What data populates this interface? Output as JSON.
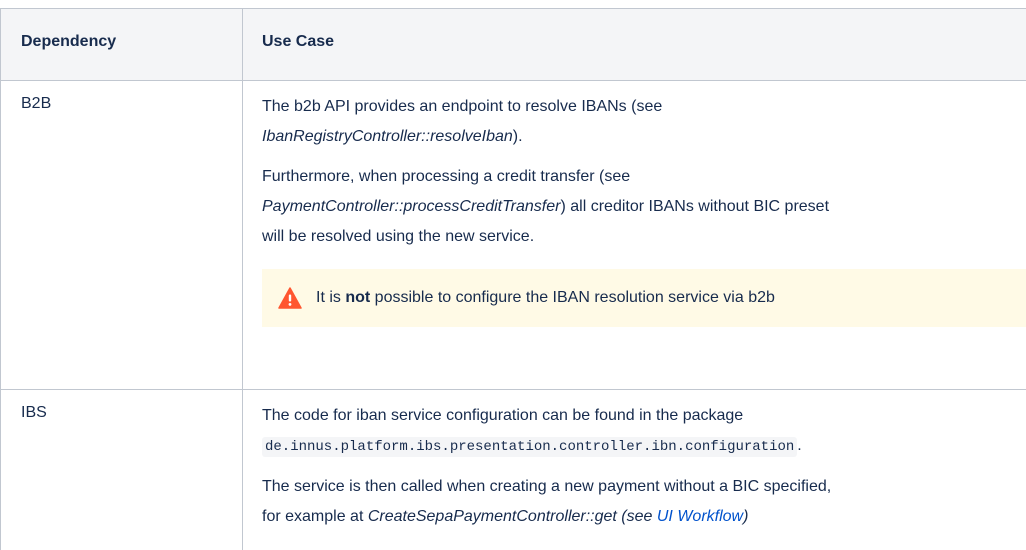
{
  "header": {
    "col1": "Dependency",
    "col2": "Use Case"
  },
  "rows": {
    "b2b": {
      "dependency": "B2B",
      "p1": {
        "a": "The b2b API provides an endpoint to resolve IBANs (see ",
        "b": "IbanRegistryController::resolveIban",
        "c": ")."
      },
      "p2": {
        "a": "Furthermore, when processing a credit transfer (see ",
        "b": "PaymentController::processCreditTransfer",
        "c": ") all creditor IBANs without BIC preset",
        "d": "will be resolved using the new service."
      },
      "warning": {
        "icon": "warning-icon",
        "a": "It is ",
        "b": "not",
        "c": " possible to configure the IBAN resolution service via b2b",
        "color": "#fffae6",
        "icon_color": "#ff5630"
      }
    },
    "ibs": {
      "dependency": "IBS",
      "p1": "The code for iban service configuration can be found in the package",
      "code": "de.innus.platform.ibs.presentation.controller.ibn.configuration",
      "code_after": ".",
      "p2": "The service is then called when creating a new payment without a BIC specified,",
      "p3": {
        "a": "for example at ",
        "b": "CreateSepaPaymentController::get (see ",
        "link": "UI Workflow",
        "c": ")"
      }
    }
  }
}
